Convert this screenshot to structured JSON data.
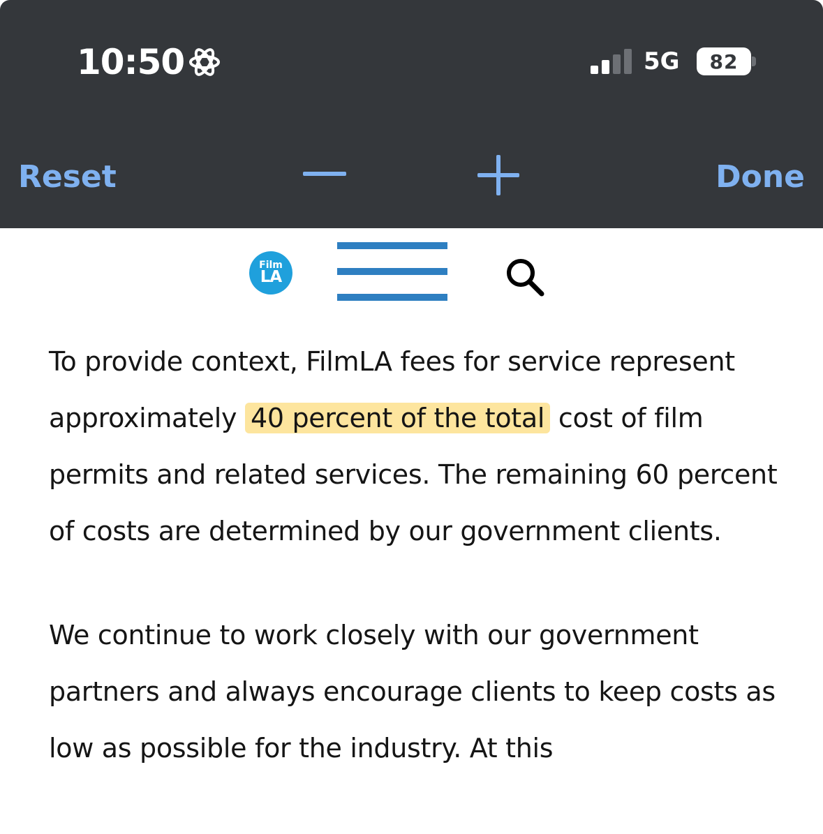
{
  "status_bar": {
    "time": "10:50",
    "network": "5G",
    "battery_level": "82",
    "signal_bars_active": 2,
    "signal_bars_total": 4
  },
  "toolbar": {
    "reset_label": "Reset",
    "done_label": "Done",
    "zoom_out_icon": "minus-icon",
    "zoom_in_icon": "plus-icon",
    "accent_color": "#7fb1f0",
    "background_color": "#34373b"
  },
  "site_header": {
    "logo_line1": "Film",
    "logo_line2": "LA",
    "menu_icon": "hamburger-icon",
    "search_icon": "search-icon",
    "logo_color": "#1fa0dc",
    "menu_color": "#2e7fc1"
  },
  "article": {
    "p1_before": "To provide context, FilmLA fees for service represent approximately ",
    "p1_highlight": "40 percent of the total",
    "p1_after": " cost of film permits and related services. The remaining 60 percent of costs are determined by our government clients.",
    "p2": "We continue to work closely with our government partners and always encourage clients to keep costs as low as possible for the industry. At this",
    "highlight_color": "#fde59e"
  }
}
